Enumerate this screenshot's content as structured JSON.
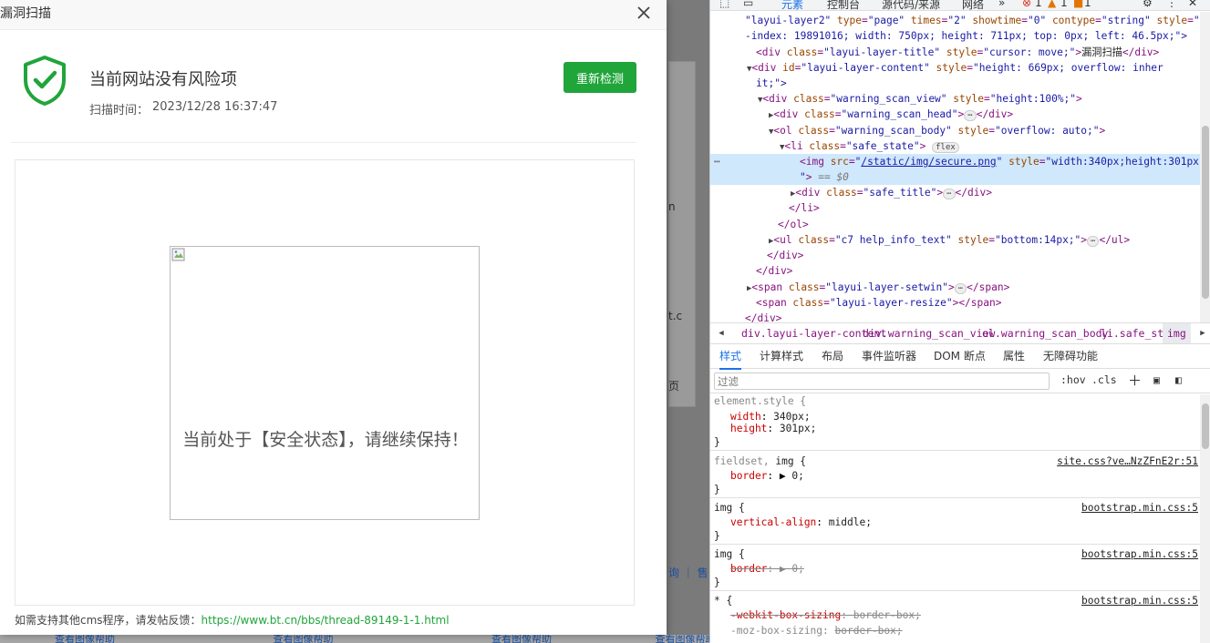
{
  "dialog": {
    "title": "漏洞扫描",
    "head_title": "当前网站没有风险项",
    "time_label": "扫描时间：",
    "time_value": "2023/12/28 16:37:47",
    "rescan_label": "重新检测",
    "safe_title": "当前处于【安全状态】，请继续保持！",
    "help_text": "如需支持其他cms程序，请发帖反馈：",
    "help_link": "https://www.bt.cn/bbs/thread-89149-1-1.html"
  },
  "background": {
    "fragment_1": "n",
    "fragment_2": "t.c",
    "fragment_3": "页",
    "fragment_4": "询 ｜ 售",
    "bottom_links": [
      "查看图像帮助",
      "查看图像帮助",
      "查看图像帮助",
      "查看图像帮助"
    ]
  },
  "devtools": {
    "toolbar": {
      "tab_elements": "元素",
      "tab_console": "控制台",
      "tab_sources": "源代码/来源",
      "tab_network": "网络",
      "more": "»",
      "errors": "1",
      "warnings": "1",
      "info": "1"
    },
    "elements": {
      "l1_a": "\"layui-layer2\"",
      "l1_b": "type",
      "l1_c": "\"page\"",
      "l1_d": "times",
      "l1_e": "\"2\"",
      "l1_f": "showtime",
      "l1_g": "\"0\"",
      "l1_h": "contype",
      "l1_i": "\"string\"",
      "l1_j": "style",
      "l1_k": "\"z",
      "l2": "-index: 19891016; width: 750px; height: 711px; top: 0px; left: 46.5px;\">",
      "l3_class": "\"layui-layer-title\"",
      "l3_style": "\"cursor: move;\"",
      "l3_text": "漏洞扫描",
      "l4_id": "\"layui-layer-content\"",
      "l4_style": "\"height: 669px; overflow: inher",
      "l5": "it;\">",
      "l6_class": "\"warning_scan_view\"",
      "l6_style": "\"height:100%;\"",
      "l7_class": "\"warning_scan_head\"",
      "l8_class": "\"warning_scan_body\"",
      "l8_style": "\"overflow: auto;\"",
      "l9_class": "\"safe_state\"",
      "l9_pill": "flex",
      "l10_src": "/static/img/secure.png",
      "l10_style": "\"width:340px;height:301px;",
      "l11_eq": "== $0",
      "l12_class": "\"safe_title\"",
      "l15_class": "\"c7 help_info_text\"",
      "l15_style": "\"bottom:14px;\"",
      "l18_class": "\"layui-layer-setwin\"",
      "l19_class": "\"layui-layer-resize\""
    },
    "breadcrumbs": [
      "div.layui-layer-content",
      "div.warning_scan_view",
      "ol.warning_scan_body",
      "li.safe_state",
      "img"
    ],
    "subtabs": [
      "样式",
      "计算样式",
      "布局",
      "事件监听器",
      "DOM 断点",
      "属性",
      "无障碍功能"
    ],
    "filter_placeholder": "过滤",
    "filter_hov": ":hov",
    "filter_cls": ".cls",
    "styles": {
      "r1_sel": "element.style {",
      "r1_p1n": "width",
      "r1_p1v": "340px;",
      "r1_p2n": "height",
      "r1_p2v": "301px;",
      "r2_sel": "fieldset, img {",
      "r2_src": "site.css?ve…NzZFnE2r:51",
      "r2_p1n": "border",
      "r2_p1v": "0;",
      "r3_sel": "img {",
      "r3_src": "bootstrap.min.css:5",
      "r3_p1n": "vertical-align",
      "r3_p1v": "middle;",
      "r4_sel": "img {",
      "r4_src": "bootstrap.min.css:5",
      "r4_p1n": "border",
      "r4_p1v": "0;",
      "r5_sel": "* {",
      "r5_src": "bootstrap.min.css:5",
      "r5_p1n": "-webkit-box-sizing",
      "r5_p1v": "border-box;",
      "r5_p2n": "-moz-box-sizing",
      "r5_p2v": "border-box;"
    }
  }
}
